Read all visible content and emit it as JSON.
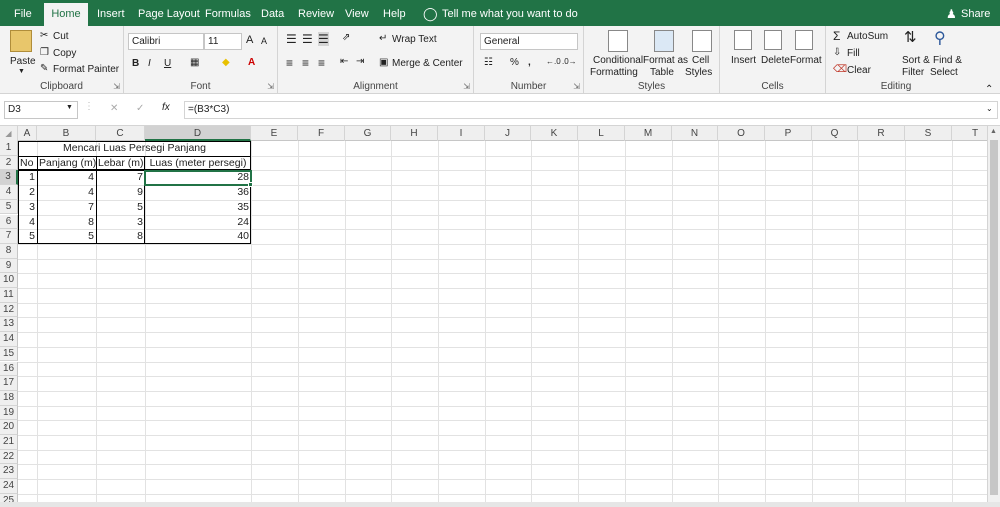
{
  "tabs": [
    "File",
    "Home",
    "Insert",
    "Page Layout",
    "Formulas",
    "Data",
    "Review",
    "View",
    "Help"
  ],
  "tell_me": "Tell me what you want to do",
  "share": "Share",
  "clipboard": {
    "paste": "Paste",
    "cut": "Cut",
    "copy": "Copy",
    "format_painter": "Format Painter",
    "label": "Clipboard"
  },
  "font": {
    "name": "Calibri",
    "size": "11",
    "label": "Font",
    "bold": "B",
    "italic": "I",
    "underline": "U",
    "grow": "A",
    "shrink": "A"
  },
  "alignment": {
    "wrap": "Wrap Text",
    "merge": "Merge & Center",
    "label": "Alignment"
  },
  "number": {
    "format": "General",
    "percent": "%",
    "comma": ",",
    "label": "Number"
  },
  "styles": {
    "cond1": "Conditional",
    "cond2": "Formatting",
    "fmt1": "Format as",
    "fmt2": "Table",
    "cell1": "Cell",
    "cell2": "Styles",
    "label": "Styles"
  },
  "cells": {
    "insert": "Insert",
    "delete": "Delete",
    "format": "Format",
    "label": "Cells"
  },
  "editing": {
    "autosum": "AutoSum",
    "fill": "Fill",
    "clear": "Clear",
    "sort1": "Sort &",
    "sort2": "Filter",
    "find1": "Find &",
    "find2": "Select",
    "label": "Editing"
  },
  "formula_bar": {
    "name_box": "D3",
    "fx": "fx",
    "formula": "=(B3*C3)"
  },
  "columns": [
    "A",
    "B",
    "C",
    "D",
    "E",
    "F",
    "G",
    "H",
    "I",
    "J",
    "K",
    "L",
    "M",
    "N",
    "O",
    "P",
    "Q",
    "R",
    "S",
    "T"
  ],
  "rows": [
    "1",
    "2",
    "3",
    "4",
    "5",
    "6",
    "7",
    "8",
    "9",
    "10",
    "11",
    "12",
    "13",
    "14",
    "15",
    "16",
    "17",
    "18",
    "19",
    "20",
    "21",
    "22",
    "23",
    "24",
    "25"
  ],
  "sheet": {
    "title": "Mencari Luas Persegi Panjang",
    "headers": [
      "No",
      "Panjang (m)",
      "Lebar (m)",
      "Luas (meter persegi)"
    ],
    "data": [
      [
        "1",
        "4",
        "7",
        "28"
      ],
      [
        "2",
        "4",
        "9",
        "36"
      ],
      [
        "3",
        "7",
        "5",
        "35"
      ],
      [
        "4",
        "8",
        "3",
        "24"
      ],
      [
        "5",
        "5",
        "8",
        "40"
      ]
    ]
  },
  "colors": {
    "excel_green": "#217346",
    "selection": "#217346"
  }
}
